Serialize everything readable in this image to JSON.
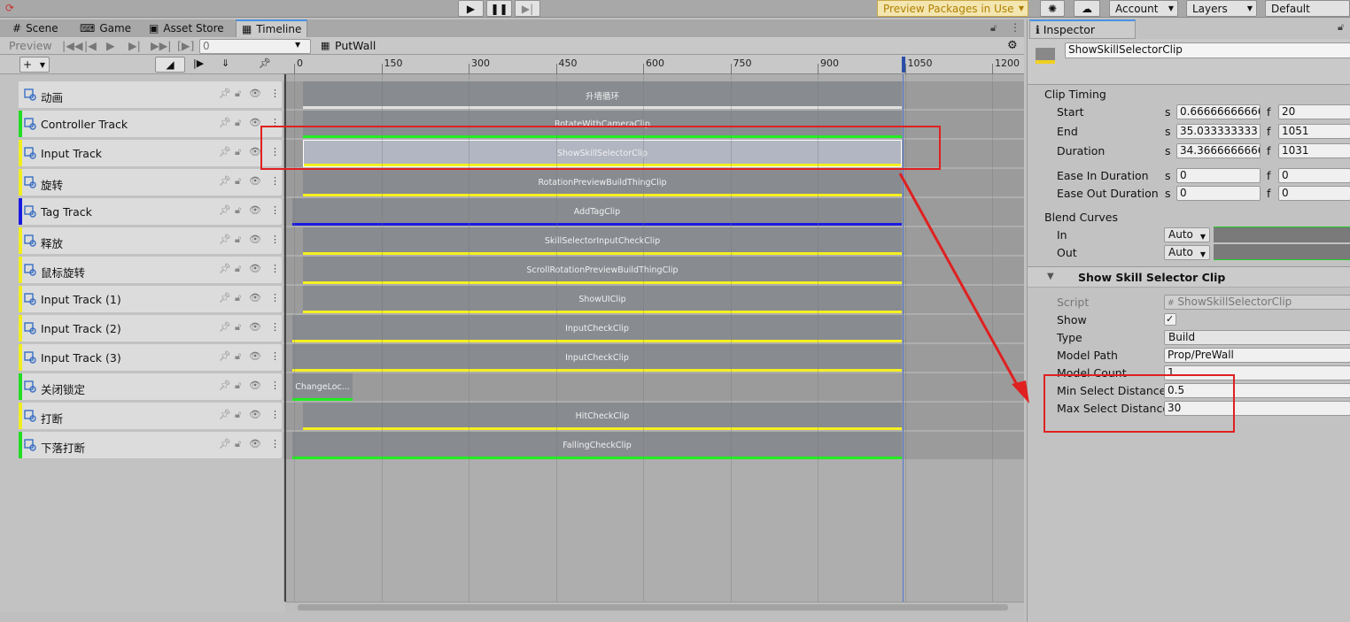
{
  "toolbar": {
    "preview_packages": "Preview Packages in Use",
    "account": "Account",
    "layers": "Layers",
    "layout": "Default"
  },
  "tabs": [
    {
      "label": "Scene"
    },
    {
      "label": "Game"
    },
    {
      "label": "Asset Store"
    },
    {
      "label": "Timeline"
    }
  ],
  "inspector_tab": "Inspector",
  "timeline": {
    "preview_label": "Preview",
    "frame_value": "0",
    "asset_name": "PutWall",
    "ruler_ticks": [
      "0",
      "150",
      "300",
      "450",
      "600",
      "750",
      "900",
      "1050",
      "1200"
    ]
  },
  "tracks": [
    {
      "name": "动画",
      "color": "#dcdcdc",
      "clip": "升墙循环",
      "clip_line": "#e0e0e0"
    },
    {
      "name": "Controller Track",
      "color": "#22dd22",
      "clip": "RotateWithCameraClip",
      "clip_line": "#22ee22"
    },
    {
      "name": "Input Track",
      "color": "#f0ee20",
      "clip": "ShowSkillSelectorClip",
      "clip_line": "#f5f020"
    },
    {
      "name": "旋转",
      "color": "#f0ee20",
      "clip": "RotationPreviewBuildThingClip",
      "clip_line": "#f5f020"
    },
    {
      "name": "Tag Track",
      "color": "#1a1ae0",
      "clip": "AddTagClip",
      "clip_line": "#1a1ae0"
    },
    {
      "name": "释放",
      "color": "#f0ee20",
      "clip": "SkillSelectorInputCheckClip",
      "clip_line": "#f5f020"
    },
    {
      "name": "鼠标旋转",
      "color": "#f0ee20",
      "clip": "ScrollRotationPreviewBuildThingClip",
      "clip_line": "#f5f020"
    },
    {
      "name": "Input Track (1)",
      "color": "#f0ee20",
      "clip": "ShowUIClip",
      "clip_line": "#f5f020"
    },
    {
      "name": "Input Track (2)",
      "color": "#f0ee20",
      "clip": "InputCheckClip",
      "clip_line": "#f5f020"
    },
    {
      "name": "Input Track (3)",
      "color": "#f0ee20",
      "clip": "InputCheckClip",
      "clip_line": "#f5f020"
    },
    {
      "name": "关闭锁定",
      "color": "#22dd22",
      "clip": "ChangeLoc...",
      "clip_line": "#22ee22"
    },
    {
      "name": "打断",
      "color": "#f0ee20",
      "clip": "HitCheckClip",
      "clip_line": "#f5f020"
    },
    {
      "name": "下落打断",
      "color": "#22dd22",
      "clip": "FallingCheckClip",
      "clip_line": "#22ee22"
    }
  ],
  "inspector": {
    "object_name": "ShowSkillSelectorClip",
    "clip_timing_header": "Clip Timing",
    "start_label": "Start",
    "start_s": "0.66666666666",
    "start_f": "20",
    "end_label": "End",
    "end_s": "35.033333333",
    "end_f": "1051",
    "duration_label": "Duration",
    "duration_s": "34.3666666666",
    "duration_f": "1031",
    "ease_in_label": "Ease In Duration",
    "ease_in_s": "0",
    "ease_in_f": "0",
    "ease_out_label": "Ease Out Duration",
    "ease_out_s": "0",
    "ease_out_f": "0",
    "s_unit": "s",
    "f_unit": "f",
    "blend_header": "Blend Curves",
    "in_label": "In",
    "in_value": "Auto",
    "out_label": "Out",
    "out_value": "Auto",
    "component_header": "Show Skill Selector Clip",
    "script_label": "Script",
    "script_value": "ShowSkillSelectorClip",
    "show_label": "Show",
    "show_checked": "✓",
    "type_label": "Type",
    "type_value": "Build",
    "model_path_label": "Model Path",
    "model_path_value": "Prop/PreWall",
    "model_count_label": "Model Count",
    "model_count_value": "1",
    "min_sel_label": "Min Select Distance",
    "min_sel_value": "0.5",
    "max_sel_label": "Max Select Distance",
    "max_sel_value": "30"
  }
}
